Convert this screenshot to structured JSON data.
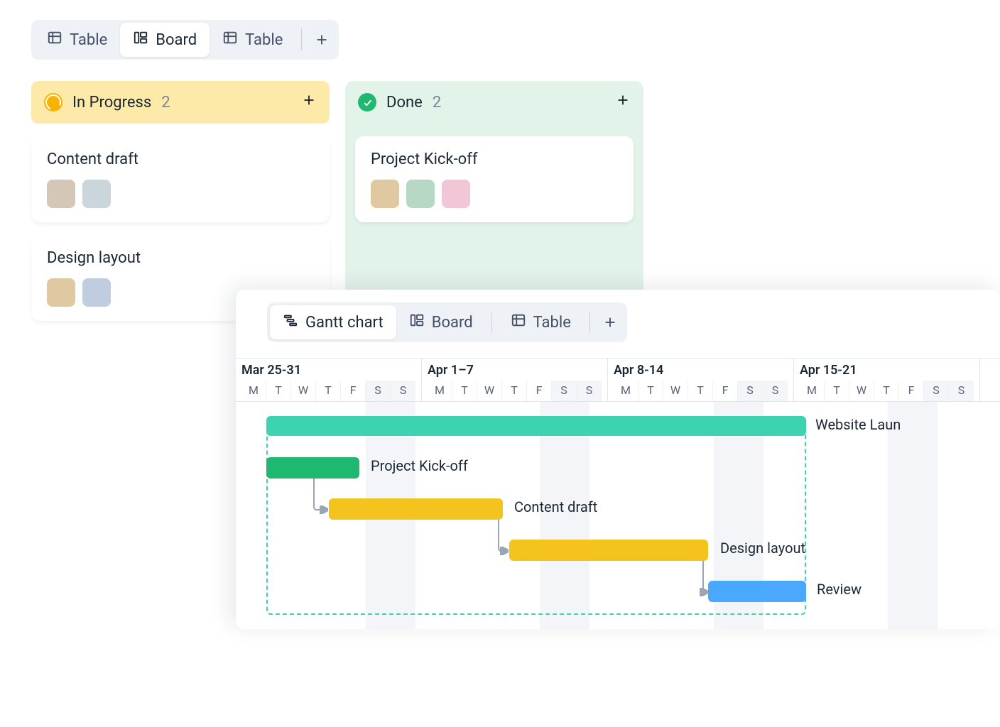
{
  "top_tabs": {
    "items": [
      {
        "label": "Table",
        "icon": "table"
      },
      {
        "label": "Board",
        "icon": "board"
      },
      {
        "label": "Table",
        "icon": "table"
      }
    ],
    "active_index": 1
  },
  "board": {
    "columns": [
      {
        "status": "In Progress",
        "count": "2",
        "style": "in-progress",
        "cards": [
          {
            "title": "Content draft",
            "avatars": 2
          },
          {
            "title": "Design layout",
            "avatars": 2
          }
        ]
      },
      {
        "status": "Done",
        "count": "2",
        "style": "done",
        "cards": [
          {
            "title": "Project Kick-off",
            "avatars": 3
          }
        ]
      }
    ]
  },
  "gantt_tabs": {
    "items": [
      {
        "label": "Gantt chart",
        "icon": "gantt"
      },
      {
        "label": "Board",
        "icon": "board"
      },
      {
        "label": "Table",
        "icon": "table"
      }
    ],
    "active_index": 0
  },
  "timeline": {
    "weeks": [
      {
        "label": "Mar 25-31",
        "days": [
          "M",
          "T",
          "W",
          "T",
          "F",
          "S",
          "S"
        ]
      },
      {
        "label": "Apr 1–7",
        "days": [
          "M",
          "T",
          "W",
          "T",
          "F",
          "S",
          "S"
        ]
      },
      {
        "label": "Apr 8-14",
        "days": [
          "M",
          "T",
          "W",
          "T",
          "F",
          "S",
          "S"
        ]
      },
      {
        "label": "Apr 15-21",
        "days": [
          "M",
          "T",
          "W",
          "T",
          "F",
          "S",
          "S"
        ]
      }
    ]
  },
  "gantt_tasks": {
    "summary": "Website Laun",
    "rows": [
      {
        "title": "Project Kick-off",
        "color": "green"
      },
      {
        "title": "Content draft",
        "color": "yellow"
      },
      {
        "title": "Design layout",
        "color": "yellow"
      },
      {
        "title": "Review",
        "color": "blue"
      }
    ]
  },
  "chart_data": {
    "type": "gantt",
    "title": "",
    "x_unit": "day",
    "x_range": [
      "2024-03-25",
      "2024-04-21"
    ],
    "weeks": [
      "Mar 25-31",
      "Apr 1–7",
      "Apr 8-14",
      "Apr 15-21"
    ],
    "day_labels": [
      "M",
      "T",
      "W",
      "T",
      "F",
      "S",
      "S"
    ],
    "tasks": [
      {
        "name": "Website Launch",
        "type": "summary",
        "start": "2024-03-26",
        "end": "2024-04-15",
        "color": "#3dd3b0"
      },
      {
        "name": "Project Kick-off",
        "start": "2024-03-26",
        "end": "2024-03-29",
        "color": "#1fb871"
      },
      {
        "name": "Content draft",
        "start": "2024-03-29",
        "end": "2024-04-04",
        "color": "#f4c31e",
        "depends_on": "Project Kick-off"
      },
      {
        "name": "Design layout",
        "start": "2024-04-05",
        "end": "2024-04-12",
        "color": "#f4c31e",
        "depends_on": "Content draft"
      },
      {
        "name": "Review",
        "start": "2024-04-12",
        "end": "2024-04-15",
        "color": "#4aa8ff",
        "depends_on": "Design layout"
      }
    ]
  },
  "avatar_colors": [
    "#d5c7b8",
    "#cbd5dc",
    "#e0c8a0",
    "#b7d8c4",
    "#f1c6d6",
    "#c0cde0"
  ]
}
